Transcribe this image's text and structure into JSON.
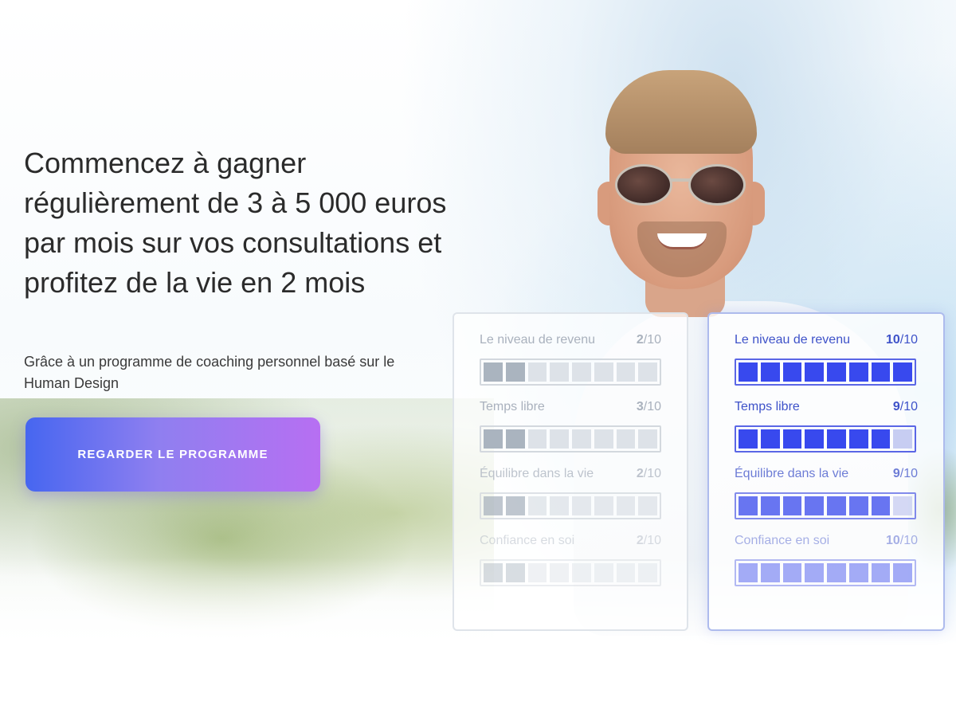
{
  "hero": {
    "headline": "Commencez à gagner régulièrement de 3 à 5 000 euros par mois sur vos consultations et profitez de la vie en 2 mois",
    "subline": "Grâce à un programme de coaching personnel basé sur le Human Design",
    "cta_label": "REGARDER LE PROGRAMME"
  },
  "cards": {
    "before": {
      "metrics": [
        {
          "label": "Le niveau de revenu",
          "score": "2",
          "max": "/10",
          "value": 2
        },
        {
          "label": "Temps libre",
          "score": "3",
          "max": "/10",
          "value": 3
        },
        {
          "label": "Équilibre dans la vie",
          "score": "2",
          "max": "/10",
          "value": 2
        },
        {
          "label": "Confiance en soi",
          "score": "2",
          "max": "/10",
          "value": 2
        }
      ]
    },
    "after": {
      "metrics": [
        {
          "label": "Le niveau de revenu",
          "score": "10",
          "max": "/10",
          "value": 10
        },
        {
          "label": "Temps libre",
          "score": "9",
          "max": "/10",
          "value": 9
        },
        {
          "label": "Équilibre dans la vie",
          "score": "9",
          "max": "/10",
          "value": 9
        },
        {
          "label": "Confiance en soi",
          "score": "10",
          "max": "/10",
          "value": 10
        }
      ]
    }
  },
  "meter_segments": 8,
  "colors": {
    "cta_start": "#4666f0",
    "cta_end": "#b76ff2",
    "after_accent": "#3849ee",
    "before_accent": "#aab4bf",
    "headline_text": "#2b2b2b"
  }
}
